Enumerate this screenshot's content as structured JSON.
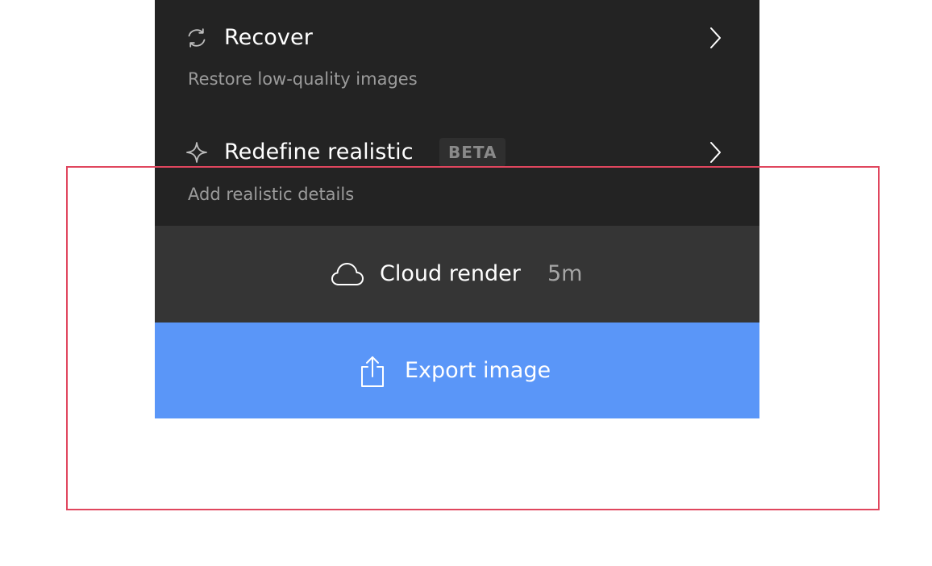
{
  "menu": {
    "items": [
      {
        "title": "Recover",
        "subtitle": "Restore low-quality images",
        "icon": "refresh-icon"
      },
      {
        "title": "Redefine realistic",
        "badge": "BETA",
        "subtitle": "Add realistic details",
        "icon": "sparkle-icon"
      }
    ]
  },
  "cloud_render": {
    "label": "Cloud render",
    "time": "5m",
    "icon": "cloud-icon"
  },
  "export": {
    "label": "Export image",
    "icon": "share-icon"
  },
  "colors": {
    "menu_bg": "#232323",
    "cloud_bg": "#353535",
    "export_bg": "#5a96f8",
    "highlight": "#e0465e",
    "subtitle_text": "#9b9b9b"
  }
}
